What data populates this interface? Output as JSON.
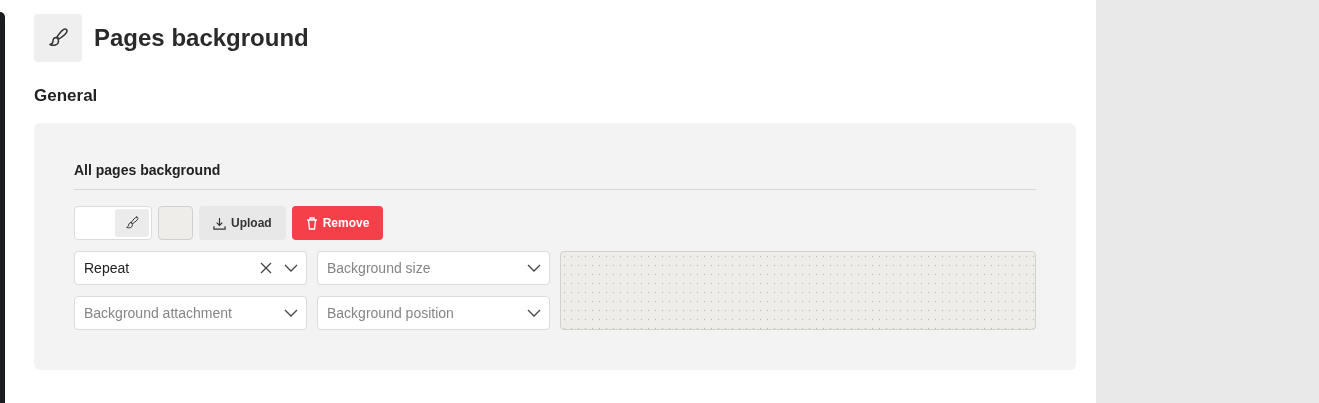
{
  "page": {
    "title": "Pages background"
  },
  "section": {
    "title": "General"
  },
  "card": {
    "title": "All pages background",
    "buttons": [
      {
        "kind": "upload",
        "label": "Upload"
      },
      {
        "kind": "remove",
        "label": "Remove"
      }
    ],
    "selects": [
      {
        "value": "Repeat",
        "clearable": true
      },
      {
        "placeholder": "Background size"
      },
      {
        "placeholder": "Background attachment"
      },
      {
        "placeholder": "Background position"
      }
    ]
  }
}
